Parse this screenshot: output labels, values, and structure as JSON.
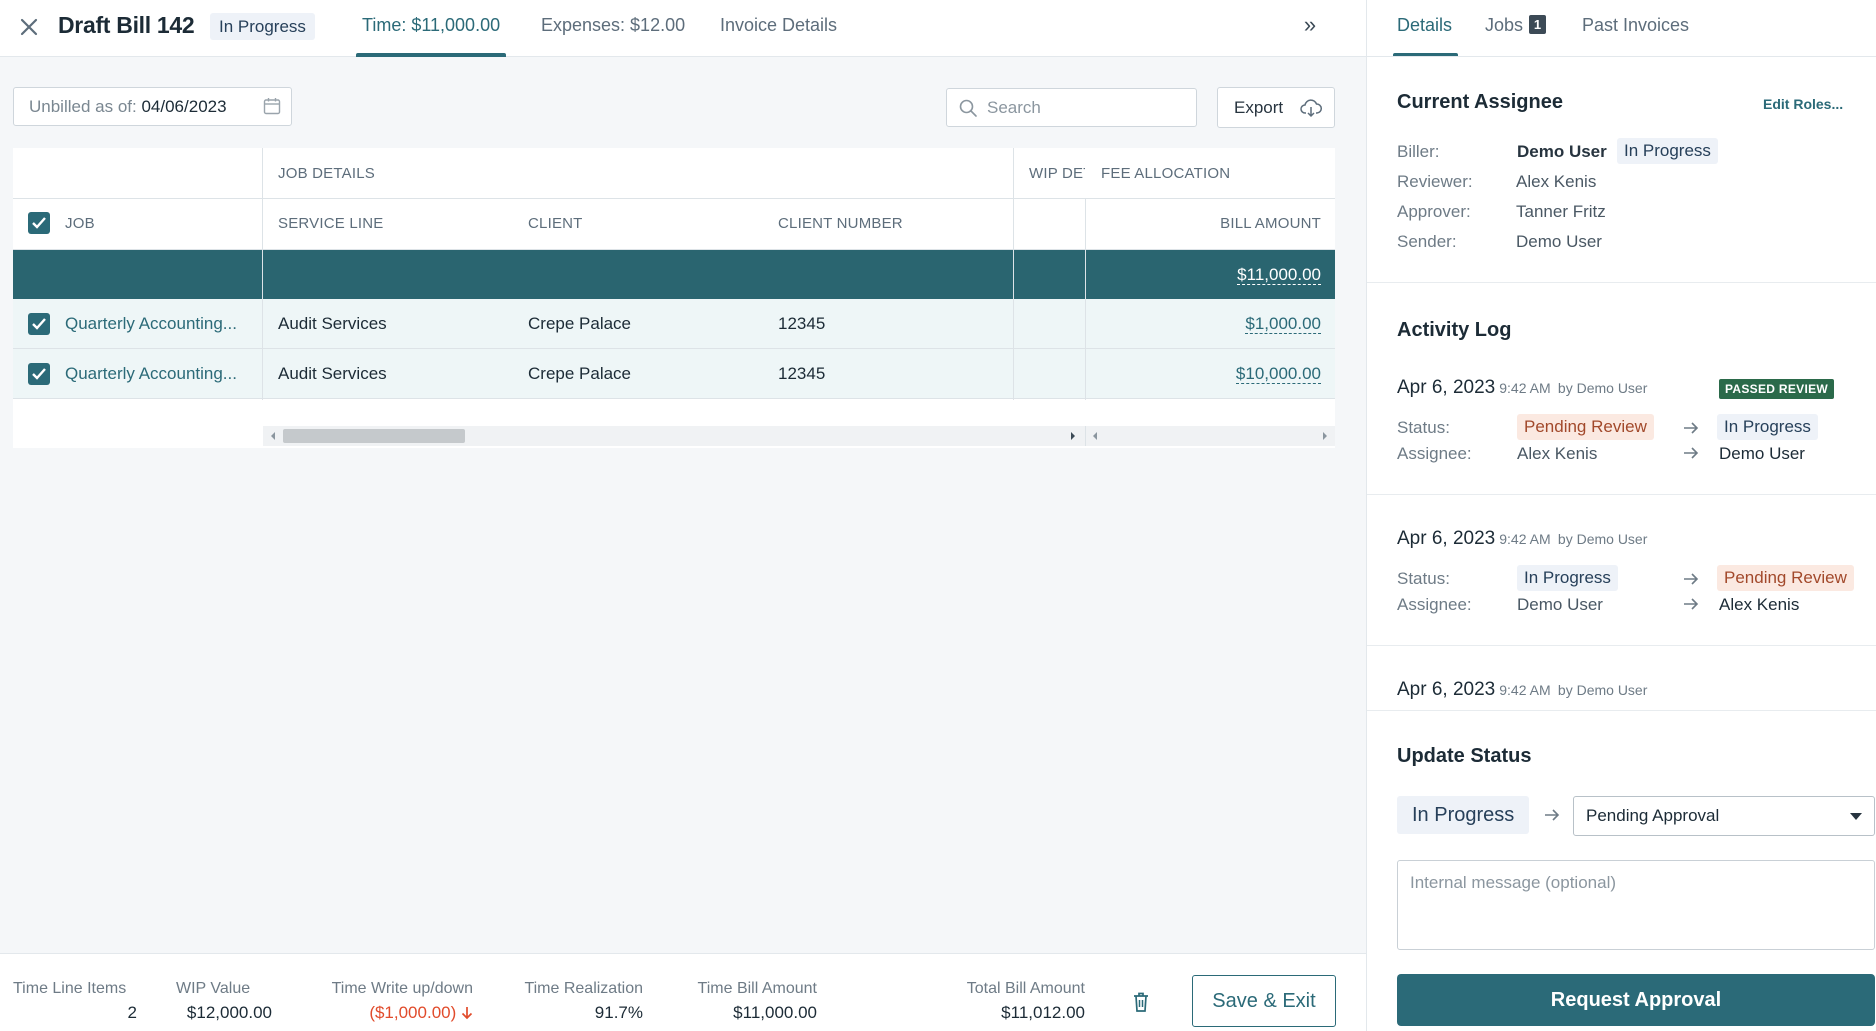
{
  "header": {
    "title": "Draft Bill 142",
    "status": "In Progress",
    "tabs": [
      {
        "label": "Time: $11,000.00"
      },
      {
        "label": "Expenses: $12.00"
      },
      {
        "label": "Invoice Details"
      }
    ]
  },
  "toolbar": {
    "unbilled_label": "Unbilled as of:",
    "unbilled_date": "04/06/2023",
    "search_placeholder": "Search",
    "export_label": "Export"
  },
  "grid": {
    "group_headers": {
      "job_details": "JOB DETAILS",
      "wip_details": "WIP DET",
      "fee_allocation": "FEE ALLOCATION"
    },
    "columns": {
      "job": "JOB",
      "service_line": "SERVICE LINE",
      "client": "CLIENT",
      "client_number": "CLIENT NUMBER",
      "bill_amount": "BILL AMOUNT"
    },
    "total_bill_amount": "$11,000.00",
    "rows": [
      {
        "job": "Quarterly Accounting...",
        "service_line": "Audit Services",
        "client": "Crepe Palace",
        "client_number": "12345",
        "bill_amount": "$1,000.00"
      },
      {
        "job": "Quarterly Accounting...",
        "service_line": "Audit Services",
        "client": "Crepe Palace",
        "client_number": "12345",
        "bill_amount": "$10,000.00"
      }
    ]
  },
  "summary": {
    "time_line_items": {
      "label": "Time Line Items",
      "value": "2"
    },
    "wip_value": {
      "label": "WIP Value",
      "value": "$12,000.00"
    },
    "time_write": {
      "label": "Time Write up/down",
      "value": "($1,000.00)"
    },
    "time_realization": {
      "label": "Time Realization",
      "value": "91.7%"
    },
    "time_bill_amount": {
      "label": "Time Bill Amount",
      "value": "$11,000.00"
    },
    "total_bill_amount": {
      "label": "Total Bill Amount",
      "value": "$11,012.00"
    },
    "save_exit_label": "Save & Exit"
  },
  "sidebar": {
    "tabs": {
      "details": "Details",
      "jobs": "Jobs",
      "jobs_count": "1",
      "past_invoices": "Past Invoices"
    },
    "assignee": {
      "title": "Current Assignee",
      "edit_roles": "Edit Roles...",
      "biller_label": "Biller:",
      "biller": "Demo User",
      "biller_status": "In Progress",
      "reviewer_label": "Reviewer:",
      "reviewer": "Alex Kenis",
      "approver_label": "Approver:",
      "approver": "Tanner Fritz",
      "sender_label": "Sender:",
      "sender": "Demo User"
    },
    "activity": {
      "title": "Activity Log",
      "entries": [
        {
          "date": "Apr 6, 2023",
          "time": "9:42 AM",
          "by": "by Demo User",
          "badge": "PASSED REVIEW",
          "status_label": "Status:",
          "status_from": "Pending Review",
          "status_to": "In Progress",
          "assignee_label": "Assignee:",
          "assignee_from": "Alex Kenis",
          "assignee_to": "Demo User"
        },
        {
          "date": "Apr 6, 2023",
          "time": "9:42 AM",
          "by": "by Demo User",
          "status_label": "Status:",
          "status_from": "In Progress",
          "status_to": "Pending Review",
          "assignee_label": "Assignee:",
          "assignee_from": "Demo User",
          "assignee_to": "Alex Kenis"
        },
        {
          "date": "Apr 6, 2023",
          "time": "9:42 AM",
          "by": "by Demo User"
        }
      ]
    },
    "update": {
      "title": "Update Status",
      "current": "In Progress",
      "next": "Pending Approval",
      "message_placeholder": "Internal message (optional)",
      "request_label": "Request Approval"
    }
  },
  "colors": {
    "accent": "#2b6a78",
    "total_row": "#2a6570",
    "negative": "#e14b2b",
    "passed_badge": "#2b6a4a"
  },
  "icons": [
    "close-icon",
    "calendar-icon",
    "search-icon",
    "cloud-download-icon",
    "double-chevron-right-icon",
    "checkbox-checked-icon",
    "trash-icon",
    "arrow-right-icon",
    "arrow-down-icon",
    "caret-down-icon"
  ]
}
